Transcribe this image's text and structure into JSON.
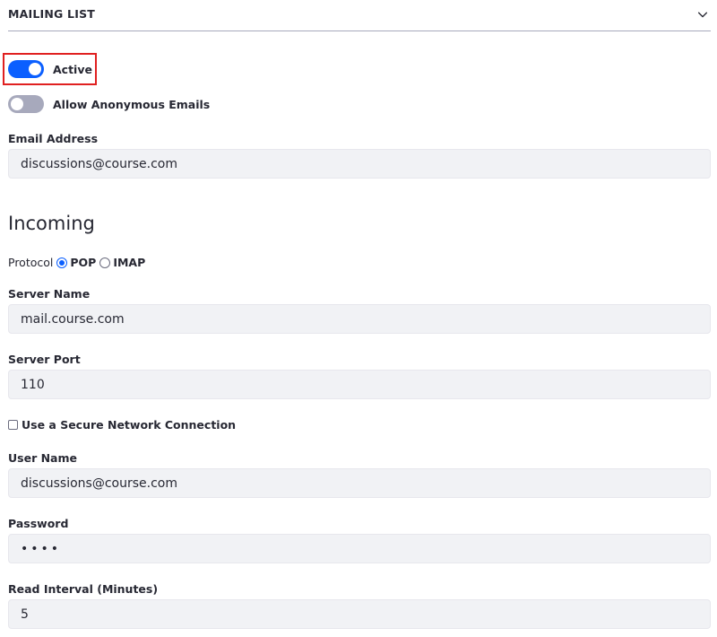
{
  "section": {
    "title": "MAILING LIST",
    "toggle_icon": "chevron-down-icon"
  },
  "active_toggle": {
    "label": "Active",
    "checked": true
  },
  "anonymous_toggle": {
    "label": "Allow Anonymous Emails",
    "checked": false
  },
  "email_address": {
    "label": "Email Address",
    "value": "discussions@course.com"
  },
  "incoming": {
    "heading": "Incoming",
    "protocol": {
      "label": "Protocol",
      "options": [
        {
          "label": "POP",
          "selected": true
        },
        {
          "label": "IMAP",
          "selected": false
        }
      ]
    },
    "server_name": {
      "label": "Server Name",
      "value": "mail.course.com"
    },
    "server_port": {
      "label": "Server Port",
      "value": "110"
    },
    "secure_connection": {
      "label": "Use a Secure Network Connection",
      "checked": false
    },
    "user_name": {
      "label": "User Name",
      "value": "discussions@course.com"
    },
    "password": {
      "label": "Password",
      "value": "••••"
    },
    "read_interval": {
      "label": "Read Interval (Minutes)",
      "value": "5"
    }
  },
  "colors": {
    "accent": "#0b5fff",
    "toggle_off": "#a7a9bc",
    "input_bg": "#f1f2f5",
    "highlight": "#e02020"
  }
}
